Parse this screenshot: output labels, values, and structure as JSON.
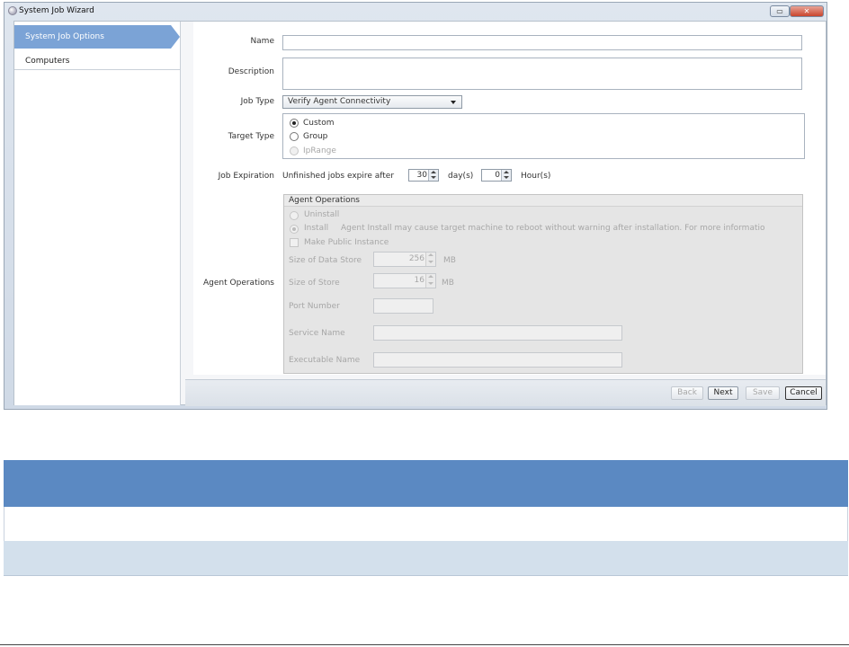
{
  "window": {
    "title": "System Job Wizard",
    "minimize_label": "▭",
    "close_label": "✕"
  },
  "sidebar": {
    "items": [
      {
        "label": "System Job Options",
        "active": true
      },
      {
        "label": "Computers",
        "active": false
      }
    ]
  },
  "form": {
    "name_label": "Name",
    "name_value": "",
    "description_label": "Description",
    "description_value": "",
    "job_type_label": "Job Type",
    "job_type_value": "Verify Agent Connectivity",
    "target_type_label": "Target Type",
    "target_options": [
      {
        "label": "Custom",
        "checked": true,
        "disabled": false
      },
      {
        "label": "Group",
        "checked": false,
        "disabled": false
      },
      {
        "label": "IpRange",
        "checked": false,
        "disabled": true
      }
    ],
    "job_expiration_label": "Job Expiration",
    "expire_prefix": "Unfinished jobs expire after",
    "expire_days": "30",
    "days_unit": "day(s)",
    "expire_hours": "0",
    "hours_unit": "Hour(s)",
    "agent_operations_label": "Agent Operations"
  },
  "agent_ops": {
    "header": "Agent Operations",
    "uninstall_label": "Uninstall",
    "install_label": "Install",
    "install_note": "Agent Install may cause target machine to reboot without warning after installation.  For more informatio",
    "make_public_label": "Make Public Instance",
    "data_store_label": "Size of Data Store",
    "data_store_value": "256",
    "data_store_unit": "MB",
    "store_label": "Size of Store",
    "store_value": "16",
    "store_unit": "MB",
    "port_label": "Port Number",
    "service_label": "Service Name",
    "executable_label": "Executable Name"
  },
  "footer": {
    "back": "Back",
    "next": "Next",
    "save": "Save",
    "cancel": "Cancel"
  }
}
